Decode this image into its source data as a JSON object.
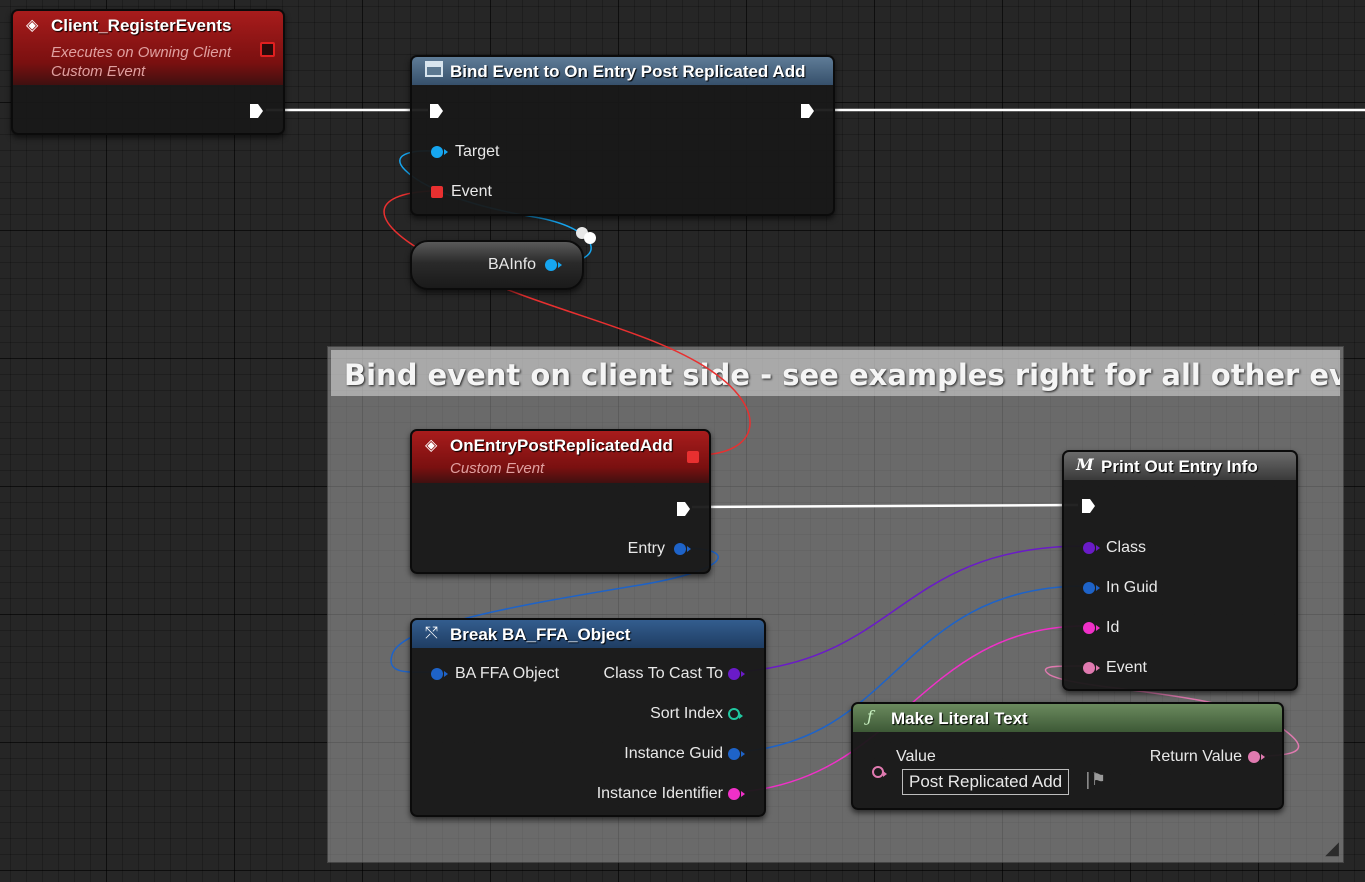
{
  "colors": {
    "exec": "#ffffff",
    "object_ref": "#16a6f0",
    "struct": "#1e63c8",
    "class": "#6a1bc8",
    "integer": "#20c8a0",
    "string_text": "#f030c8",
    "text_pink": "#e07ab0",
    "delegate": "#e83030"
  },
  "comment": {
    "title": "Bind event on client side - see examples right for all other events"
  },
  "nodes": {
    "client_register": {
      "title": "Client_RegisterEvents",
      "subtitle1": "Executes on Owning Client",
      "subtitle2": "Custom Event",
      "icon": "event-diamond-icon"
    },
    "bind_event": {
      "title": "Bind Event to On Entry Post Replicated Add",
      "icon": "function-window-icon",
      "pins": {
        "target": "Target",
        "event": "Event"
      }
    },
    "bainfo": {
      "label": "BAInfo"
    },
    "on_entry": {
      "title": "OnEntryPostReplicatedAdd",
      "subtitle": "Custom Event",
      "icon": "event-diamond-icon",
      "pins": {
        "entry": "Entry"
      }
    },
    "break_obj": {
      "title": "Break BA_FFA_Object",
      "icon": "break-struct-icon",
      "pins": {
        "input": "BA FFA Object",
        "class_to_cast": "Class To Cast To",
        "sort_index": "Sort Index",
        "instance_guid": "Instance Guid",
        "instance_identifier": "Instance Identifier"
      }
    },
    "print_out": {
      "title": "Print Out Entry Info",
      "icon": "macro-m-icon",
      "pins": {
        "class": "Class",
        "in_guid": "In Guid",
        "id": "Id",
        "event": "Event"
      }
    },
    "make_literal": {
      "title": "Make Literal Text",
      "icon": "function-f-icon",
      "pins": {
        "value": "Value",
        "return_value": "Return Value"
      },
      "value_text": "Post Replicated Add"
    }
  }
}
